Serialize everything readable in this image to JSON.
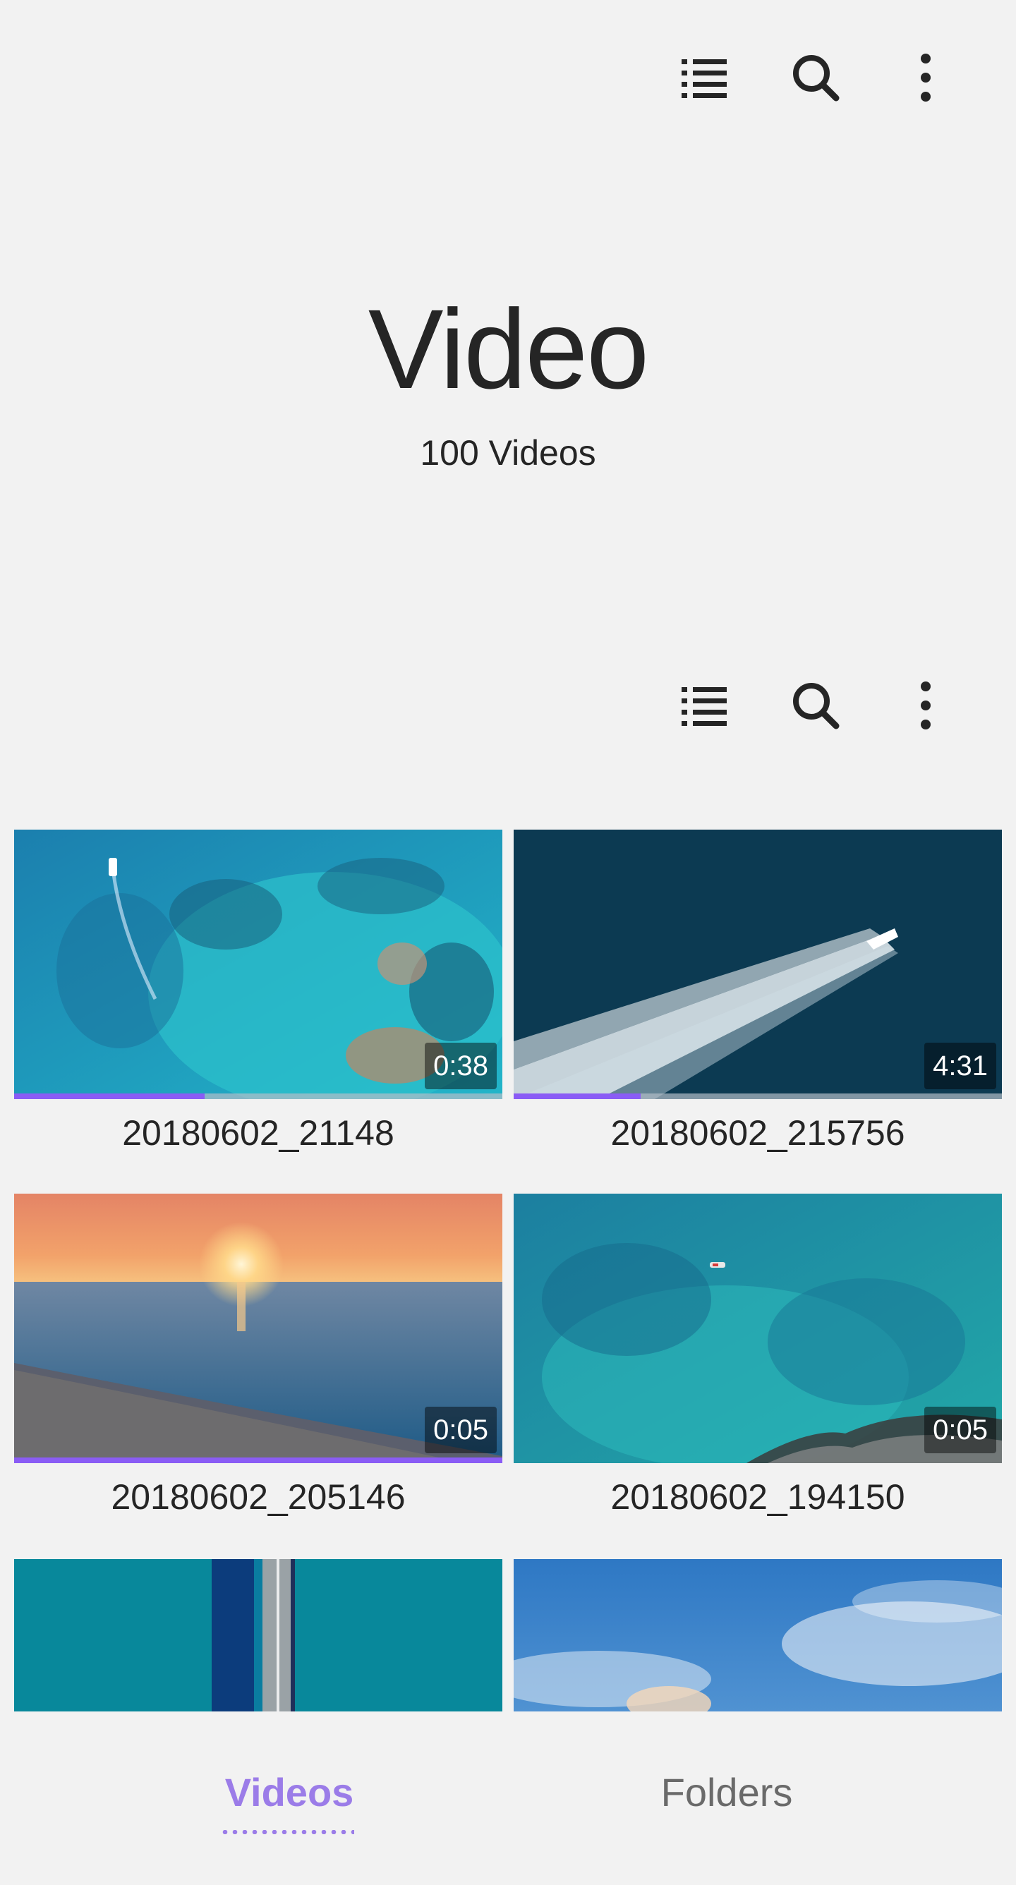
{
  "toolbar_top": {
    "icons": [
      "list-view-icon",
      "search-icon",
      "more-options-icon"
    ]
  },
  "header": {
    "title": "Video",
    "count_text": "100 Videos"
  },
  "toolbar_mid": {
    "icons": [
      "list-view-icon",
      "search-icon",
      "more-options-icon"
    ]
  },
  "videos": [
    {
      "name": "20180602_21148",
      "duration": "0:38",
      "progress": 0.39,
      "scene": "aerial turquoise rocky coast with boat"
    },
    {
      "name": "20180602_215756",
      "duration": "4:31",
      "progress": 0.26,
      "scene": "aerial speedboat wake on deep blue sea"
    },
    {
      "name": "20180602_205146",
      "duration": "0:05",
      "progress": 1.0,
      "scene": "sunset over sea and beach"
    },
    {
      "name": "20180602_194150",
      "duration": "0:05",
      "progress": 0.0,
      "scene": "aerial turquoise sea with small boat and rocks"
    },
    {
      "name": "",
      "duration": "",
      "progress": 0.0,
      "scene": "aerial bridge over teal water"
    },
    {
      "name": "",
      "duration": "",
      "progress": 0.0,
      "scene": "blue sky with clouds"
    }
  ],
  "bottom_nav": {
    "tabs": [
      {
        "label": "Videos",
        "active": true
      },
      {
        "label": "Folders",
        "active": false
      }
    ]
  },
  "colors": {
    "background": "#f2f2f2",
    "accent": "#8a5cf5",
    "active_tab": "#9b7ce8",
    "text": "#252525",
    "inactive_tab": "#6a6a6a"
  }
}
